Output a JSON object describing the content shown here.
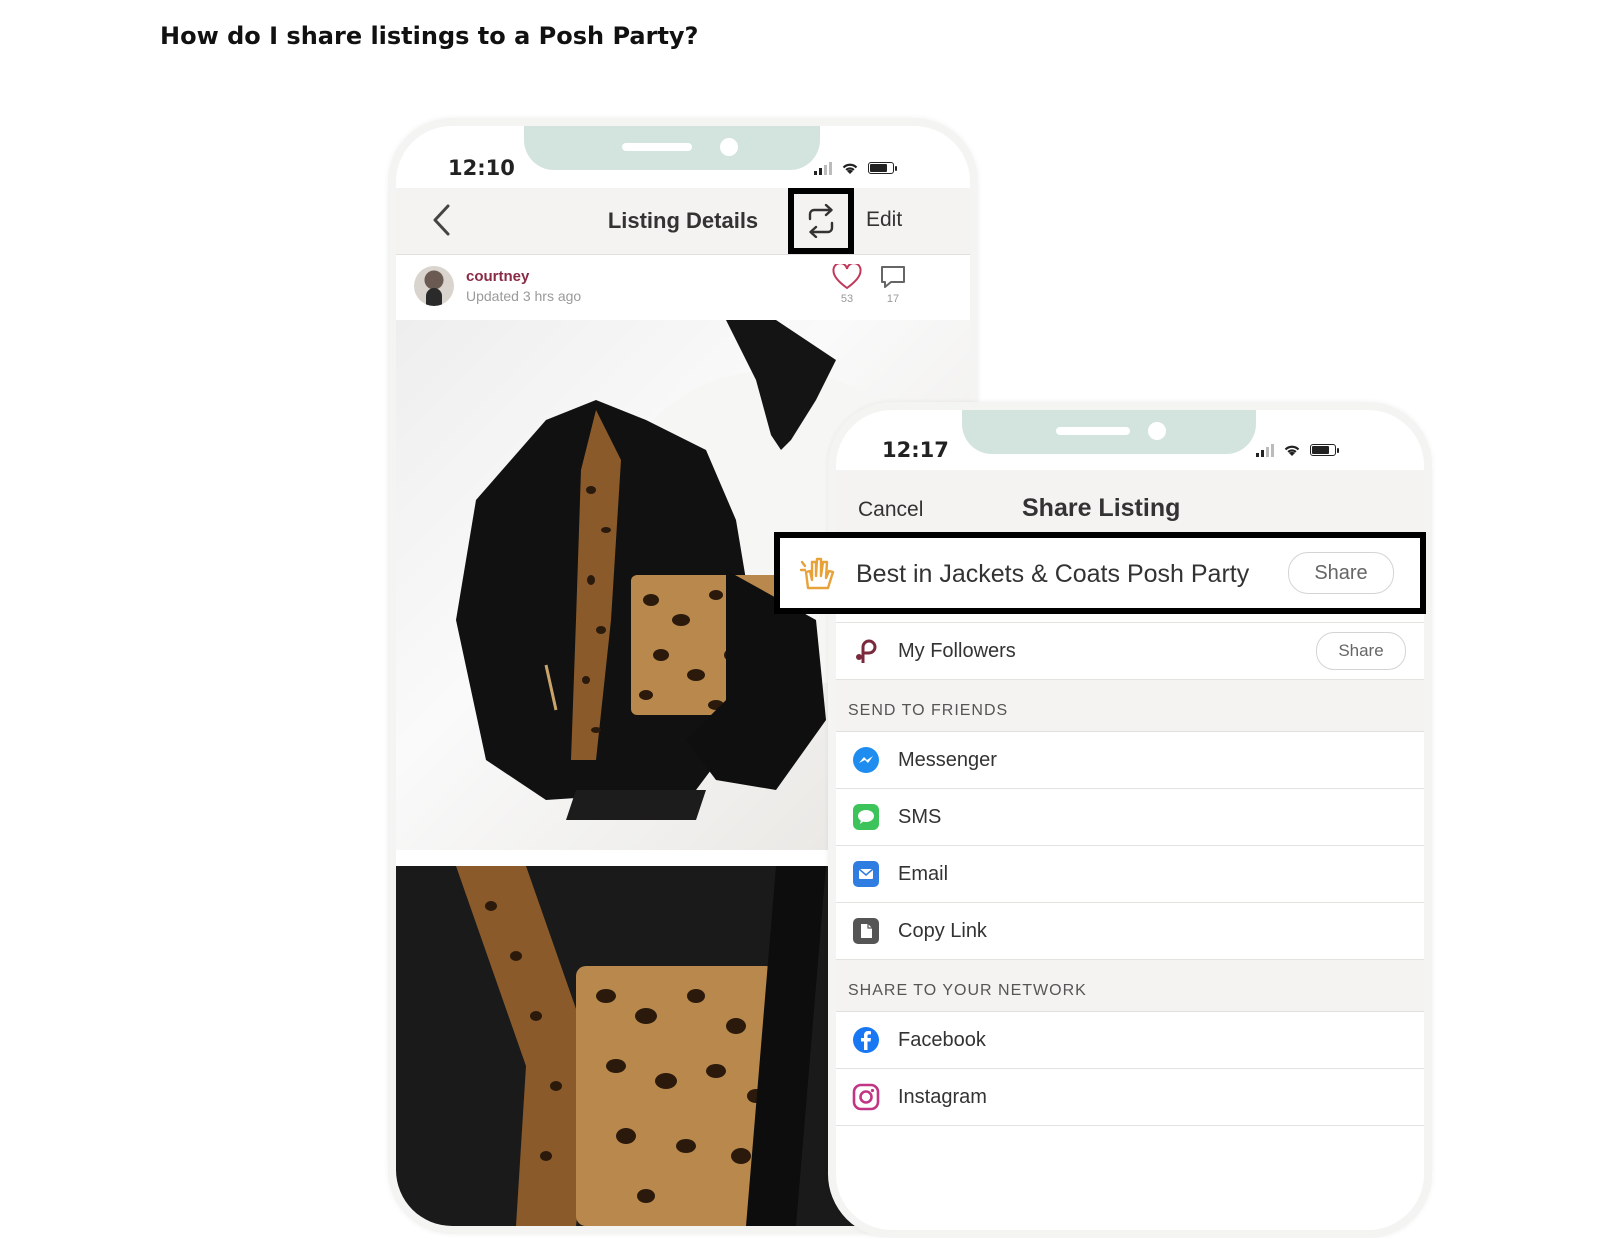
{
  "page": {
    "heading": "How do I share listings to a Posh Party?"
  },
  "phone1": {
    "time": "12:10",
    "nav_title": "Listing Details",
    "edit_label": "Edit",
    "username": "courtney",
    "updated": "Updated 3 hrs ago",
    "likes": "53",
    "comments": "17"
  },
  "phone2": {
    "time": "12:17",
    "cancel_label": "Cancel",
    "nav_title": "Share Listing",
    "party_label": "Best in Jackets & Coats Posh Party",
    "party_share": "Share",
    "followers_label": "My Followers",
    "followers_share": "Share",
    "section_friends": "SEND TO FRIENDS",
    "friends": [
      {
        "label": "Messenger",
        "icon": "messenger-icon"
      },
      {
        "label": "SMS",
        "icon": "sms-icon"
      },
      {
        "label": "Email",
        "icon": "email-icon"
      },
      {
        "label": "Copy Link",
        "icon": "copy-link-icon"
      }
    ],
    "section_network": "SHARE TO YOUR NETWORK",
    "network": [
      {
        "label": "Facebook",
        "icon": "facebook-icon"
      },
      {
        "label": "Instagram",
        "icon": "instagram-icon"
      }
    ]
  },
  "colors": {
    "username": "#8a2a45",
    "notch": "#d3e4de",
    "highlight_border": "#000000",
    "party_icon": "#e8a23a"
  }
}
